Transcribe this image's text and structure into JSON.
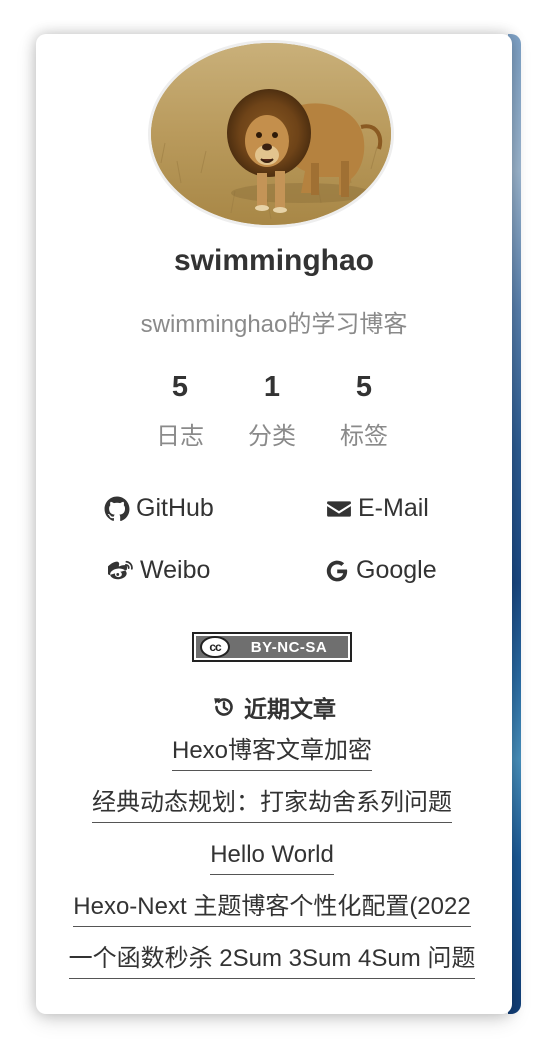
{
  "author": {
    "name": "swimminghao",
    "description": "swimminghao的学习博客"
  },
  "stats": [
    {
      "count": "5",
      "label": "日志"
    },
    {
      "count": "1",
      "label": "分类"
    },
    {
      "count": "5",
      "label": "标签"
    }
  ],
  "social": [
    {
      "label": "GitHub",
      "icon": "github-icon"
    },
    {
      "label": "E-Mail",
      "icon": "envelope-icon"
    },
    {
      "label": "Weibo",
      "icon": "weibo-icon"
    },
    {
      "label": "Google",
      "icon": "google-icon"
    }
  ],
  "license": {
    "text": "BY-NC-SA",
    "logo_text": "cc"
  },
  "recent": {
    "title": "近期文章",
    "icon": "history-icon",
    "posts": [
      "Hexo博客文章加密",
      "经典动态规划：打家劫舍系列问题",
      "Hello World",
      "Hexo-Next 主题博客个性化配置(2022",
      "一个函数秒杀 2Sum 3Sum 4Sum 问题"
    ]
  },
  "colors": {
    "text": "#333333",
    "muted": "#8a8a8a",
    "card_bg": "#ffffff",
    "cc_bg": "#6f6f6f"
  }
}
